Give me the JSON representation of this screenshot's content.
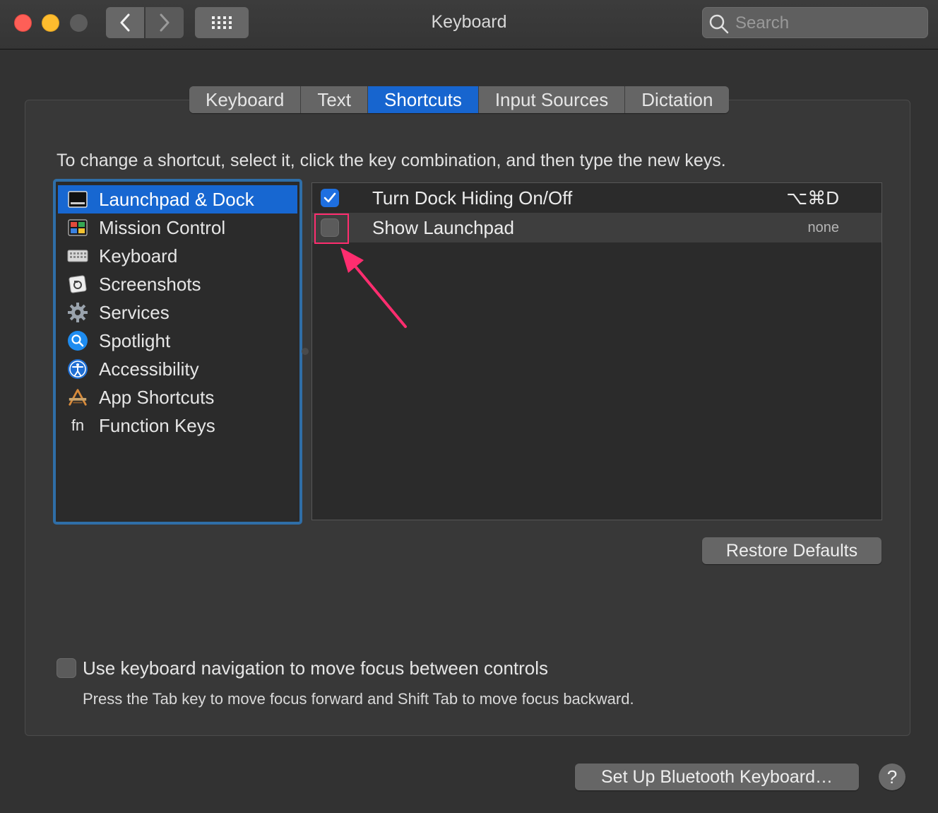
{
  "window": {
    "title": "Keyboard",
    "search_placeholder": "Search"
  },
  "tabs": [
    {
      "label": "Keyboard"
    },
    {
      "label": "Text"
    },
    {
      "label": "Shortcuts",
      "selected": true
    },
    {
      "label": "Input Sources"
    },
    {
      "label": "Dictation"
    }
  ],
  "instruction": "To change a shortcut, select it, click the key combination, and then type the new keys.",
  "categories": [
    {
      "label": "Launchpad & Dock",
      "icon": "launchpad-dock-icon",
      "selected": true
    },
    {
      "label": "Mission Control",
      "icon": "mission-control-icon"
    },
    {
      "label": "Keyboard",
      "icon": "keyboard-icon"
    },
    {
      "label": "Screenshots",
      "icon": "screenshot-icon"
    },
    {
      "label": "Services",
      "icon": "gear-icon"
    },
    {
      "label": "Spotlight",
      "icon": "spotlight-icon"
    },
    {
      "label": "Accessibility",
      "icon": "accessibility-icon"
    },
    {
      "label": "App Shortcuts",
      "icon": "app-shortcuts-icon"
    },
    {
      "label": "Function Keys",
      "icon": "fn-icon",
      "icon_text": "fn"
    }
  ],
  "shortcuts": [
    {
      "name": "Turn Dock Hiding On/Off",
      "keys": "⌥⌘D",
      "checked": true
    },
    {
      "name": "Show Launchpad",
      "keys": "none",
      "checked": false
    }
  ],
  "buttons": {
    "restore_defaults": "Restore Defaults",
    "bluetooth": "Set Up Bluetooth Keyboard…",
    "help": "?"
  },
  "keyboard_navigation": {
    "label": "Use keyboard navigation to move focus between controls",
    "hint": "Press the Tab key to move focus forward and Shift Tab to move focus backward.",
    "checked": false
  },
  "colors": {
    "accent": "#1767d1",
    "annotation": "#ff2d6f"
  }
}
